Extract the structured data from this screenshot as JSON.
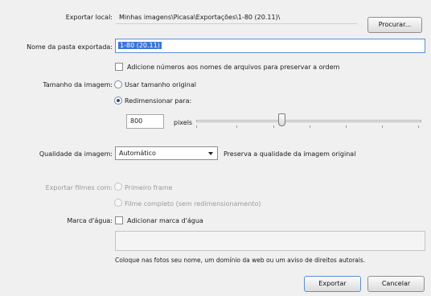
{
  "export_location": {
    "label": "Exportar local:",
    "value": "Minhas imagens\\Picasa\\Exportações\\1-80 (20.11)\\",
    "browse_label": "Procurar..."
  },
  "folder_name": {
    "label": "Nome da pasta exportada:",
    "value": "1-80 (20.11)"
  },
  "add_numbers": {
    "label": "Adicione números aos nomes de arquivos para preservar a ordem",
    "checked": false
  },
  "image_size": {
    "label": "Tamanho da imagem:",
    "original_option": "Usar tamanho original",
    "resize_option": "Redimensionar para:",
    "selected": "resize",
    "pixels_value": "800",
    "pixels_unit": "pixels",
    "slider_fraction": 0.38
  },
  "image_quality": {
    "label": "Qualidade da imagem:",
    "selected": "Automático",
    "description": "Preserva a qualidade da imagem original"
  },
  "export_videos": {
    "label": "Exportar filmes com:",
    "first_frame": "Primeiro frame",
    "full_video": "Filme completo (sem redimensionamento)"
  },
  "watermark": {
    "label": "Marca d'água:",
    "checkbox_label": "Adicionar marca d'água",
    "checked": false,
    "text_value": "",
    "hint": "Coloque nas fotos seu nome, um domínio da web ou um aviso de direitos autorais."
  },
  "buttons": {
    "export_label": "Exportar",
    "cancel_label": "Cancelar"
  }
}
